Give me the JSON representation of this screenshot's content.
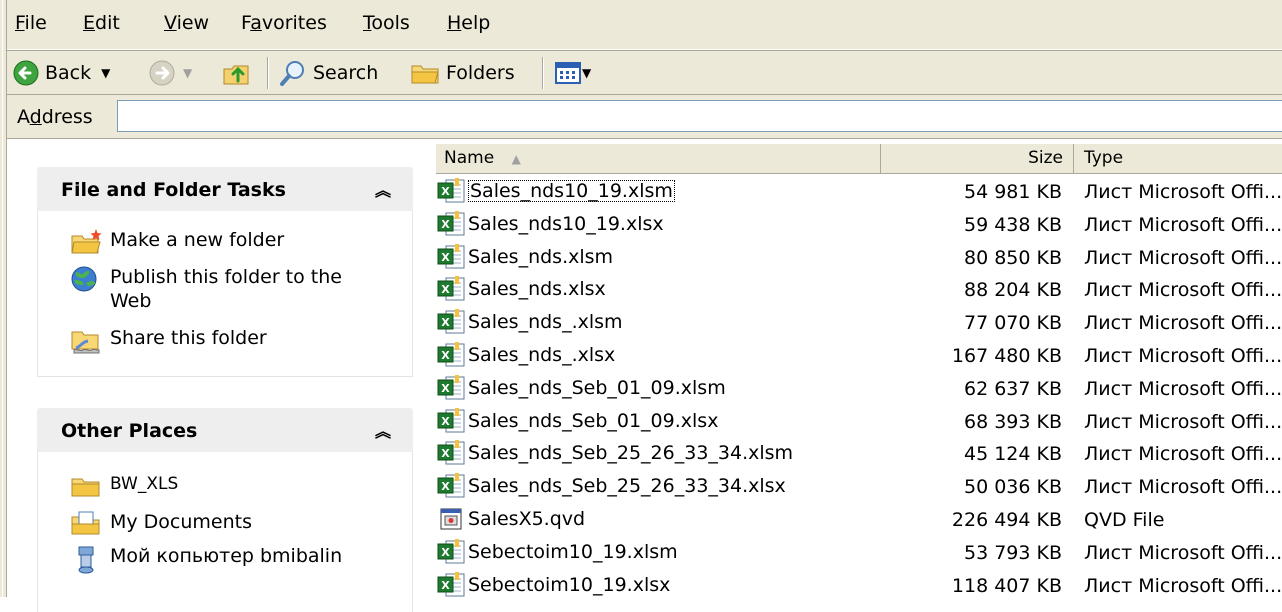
{
  "menu": {
    "file": {
      "u": "F",
      "rest": "ile"
    },
    "edit": {
      "u": "E",
      "rest": "dit"
    },
    "view": {
      "u": "V",
      "rest": "iew"
    },
    "favorites": {
      "pre": "F",
      "u": "a",
      "rest": "vorites"
    },
    "tools": {
      "u": "T",
      "rest": "ools"
    },
    "help": {
      "u": "H",
      "rest": "elp"
    }
  },
  "toolbar": {
    "back_label": "Back",
    "search_label": "Search",
    "folders_label": "Folders"
  },
  "address": {
    "label_pre": "A",
    "label_u": "d",
    "label_rest": "dress",
    "value": ""
  },
  "file_tasks": {
    "title": "File and Folder Tasks",
    "items": [
      {
        "label": "Make a new folder",
        "icon": "new-folder-icon"
      },
      {
        "label": "Publish this folder to the Web",
        "icon": "globe-icon"
      },
      {
        "label": "Share this folder",
        "icon": "share-folder-icon"
      }
    ]
  },
  "other_places": {
    "title": "Other Places",
    "items": [
      {
        "label": "BW_XLS",
        "icon": "folder-icon"
      },
      {
        "label": "My Documents",
        "icon": "my-documents-icon"
      },
      {
        "label": "Мой копьютер bmibalin",
        "icon": "computer-icon"
      }
    ]
  },
  "columns": {
    "name": "Name",
    "size": "Size",
    "type": "Type"
  },
  "files": [
    {
      "name": "Sales_nds10_19.xlsm",
      "size": "54 981 KB",
      "type": "Лист Microsoft Offi...",
      "icon": "excel-icon"
    },
    {
      "name": "Sales_nds10_19.xlsx",
      "size": "59 438 KB",
      "type": "Лист Microsoft Offi...",
      "icon": "excel-icon"
    },
    {
      "name": "Sales_nds.xlsm",
      "size": "80 850 KB",
      "type": "Лист Microsoft Offi...",
      "icon": "excel-icon"
    },
    {
      "name": "Sales_nds.xlsx",
      "size": "88 204 KB",
      "type": "Лист Microsoft Offi...",
      "icon": "excel-icon"
    },
    {
      "name": "Sales_nds_.xlsm",
      "size": "77 070 KB",
      "type": "Лист Microsoft Offi...",
      "icon": "excel-icon"
    },
    {
      "name": "Sales_nds_.xlsx",
      "size": "167 480 KB",
      "type": "Лист Microsoft Offi...",
      "icon": "excel-icon"
    },
    {
      "name": "Sales_nds_Seb_01_09.xlsm",
      "size": "62 637 KB",
      "type": "Лист Microsoft Offi...",
      "icon": "excel-icon"
    },
    {
      "name": "Sales_nds_Seb_01_09.xlsx",
      "size": "68 393 KB",
      "type": "Лист Microsoft Offi...",
      "icon": "excel-icon"
    },
    {
      "name": "Sales_nds_Seb_25_26_33_34.xlsm",
      "size": "45 124 KB",
      "type": "Лист Microsoft Offi...",
      "icon": "excel-icon"
    },
    {
      "name": "Sales_nds_Seb_25_26_33_34.xlsx",
      "size": "50 036 KB",
      "type": "Лист Microsoft Offi...",
      "icon": "excel-icon"
    },
    {
      "name": "SalesX5.qvd",
      "size": "226 494 KB",
      "type": "QVD File",
      "icon": "qvd-file-icon"
    },
    {
      "name": "Sebectoim10_19.xlsm",
      "size": "53 793 KB",
      "type": "Лист Microsoft Offi...",
      "icon": "excel-icon"
    },
    {
      "name": "Sebectoim10_19.xlsx",
      "size": "118 407 KB",
      "type": "Лист Microsoft Offi...",
      "icon": "excel-icon"
    }
  ]
}
